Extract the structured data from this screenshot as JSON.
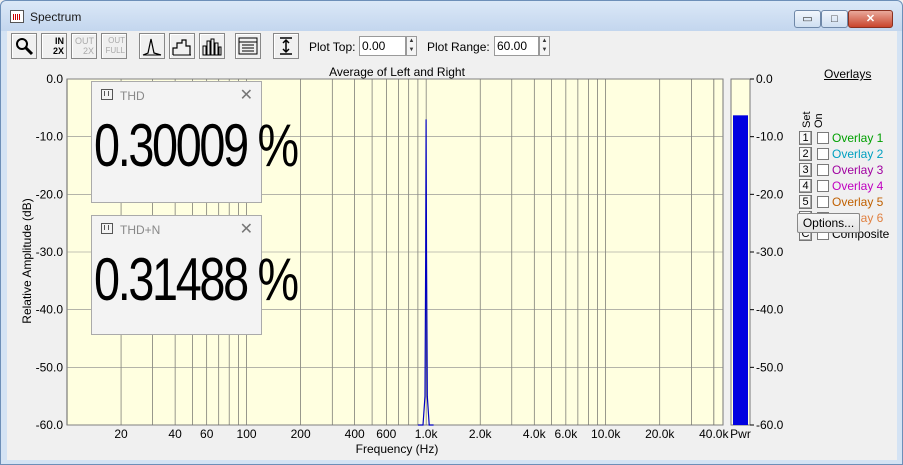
{
  "window": {
    "title": "Spectrum",
    "min_glyph": "▭",
    "max_glyph": "□",
    "close_glyph": "✕"
  },
  "toolbar": {
    "buttons": [
      {
        "name": "zoom-button",
        "icon": "magnifier-icon"
      },
      {
        "name": "zoom-in-2x-button",
        "icon": "zoom-in-2x-icon",
        "line1": "IN",
        "line2": "2X"
      },
      {
        "name": "zoom-out-2x-button",
        "icon": "zoom-out-2x-icon",
        "line1": "OUT",
        "line2": "2X"
      },
      {
        "name": "zoom-out-full-button",
        "icon": "zoom-out-full-icon",
        "line1": "OUT",
        "line2": "FULL"
      },
      {
        "name": "line-plot-button",
        "icon": "line-plot-icon"
      },
      {
        "name": "step-plot-button",
        "icon": "step-plot-icon"
      },
      {
        "name": "bar-plot-button",
        "icon": "bar-plot-icon"
      },
      {
        "name": "settings-table-button",
        "icon": "table-icon"
      },
      {
        "name": "autoscale-button",
        "icon": "vertical-range-icon"
      }
    ],
    "plot_top_label": "Plot Top:",
    "plot_top_value": "0.00",
    "plot_range_label": "Plot Range:",
    "plot_range_value": "60.00"
  },
  "plot": {
    "title": "Average of Left and Right",
    "xlabel": "Frequency (Hz)",
    "ylabel": "Relative Amplitude (dB)",
    "bg_color": "#ffffe0",
    "trace_color": "#0000c0"
  },
  "chart_data": {
    "type": "line",
    "title": "Average of Left and Right",
    "xlabel": "Frequency (Hz)",
    "ylabel": "Relative Amplitude (dB)",
    "x_scale": "log",
    "xlim": [
      10,
      45000
    ],
    "ylim": [
      -60,
      0
    ],
    "x_ticks": [
      20,
      40,
      60,
      100,
      200,
      400,
      600,
      1000,
      2000,
      4000,
      6000,
      10000,
      20000,
      40000
    ],
    "x_tick_labels": [
      "20",
      "40",
      "60",
      "100",
      "200",
      "400",
      "600",
      "1.0k",
      "2.0k",
      "4.0k",
      "6.0k",
      "10.0k",
      "20.0k",
      "40.0k"
    ],
    "y_ticks": [
      0,
      -10,
      -20,
      -30,
      -40,
      -50,
      -60
    ],
    "y_tick_labels": [
      "0.0",
      "-10.0",
      "-20.0",
      "-30.0",
      "-40.0",
      "-50.0",
      "-60.0"
    ],
    "grid": true,
    "series": [
      {
        "x": [
          900,
          960,
          985,
          995,
          1000,
          1005,
          1015,
          1040,
          1100
        ],
        "y": [
          -60,
          -60,
          -55,
          -30,
          -7,
          -30,
          -55,
          -60,
          -60
        ]
      }
    ]
  },
  "power_meter": {
    "label": "Pwr",
    "value_db": -6.3,
    "fill_color": "#0000e0",
    "tick_labels": [
      "0.0",
      "-10.0",
      "-20.0",
      "-30.0",
      "-40.0",
      "-50.0",
      "-60.0"
    ]
  },
  "meters": [
    {
      "name": "THD",
      "value": "0.30009 %",
      "close": "✕"
    },
    {
      "name": "THD+N",
      "value": "0.31488 %",
      "close": "✕"
    }
  ],
  "overlays": {
    "title": "Overlays",
    "set_label": "Set",
    "on_label": "On",
    "items": [
      {
        "key": "1",
        "label": "Overlay 1",
        "color": "#00a000"
      },
      {
        "key": "2",
        "label": "Overlay 2",
        "color": "#00a0c0"
      },
      {
        "key": "3",
        "label": "Overlay 3",
        "color": "#a000a0"
      },
      {
        "key": "4",
        "label": "Overlay 4",
        "color": "#c000c0"
      },
      {
        "key": "5",
        "label": "Overlay 5",
        "color": "#c06000"
      },
      {
        "key": "6",
        "label": "Overlay 6",
        "color": "#e08040"
      },
      {
        "key": "C",
        "label": "Composite",
        "color": "#000000"
      }
    ],
    "options_label": "Options..."
  }
}
